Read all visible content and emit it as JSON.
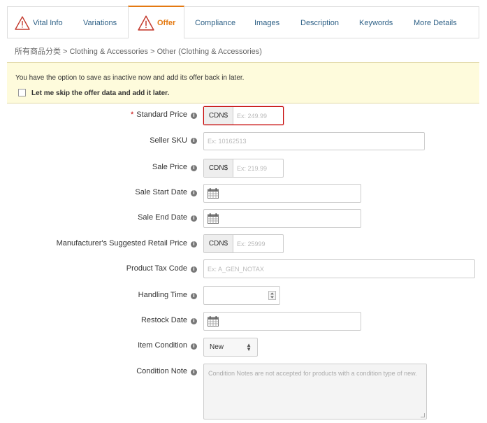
{
  "tabs": [
    {
      "label": "Vital Info",
      "warning": true
    },
    {
      "label": "Variations"
    },
    {
      "label": "Offer",
      "warning": true,
      "active": true
    },
    {
      "label": "Compliance"
    },
    {
      "label": "Images"
    },
    {
      "label": "Description"
    },
    {
      "label": "Keywords"
    },
    {
      "label": "More Details"
    }
  ],
  "breadcrumb": "所有商品分类 > Clothing & Accessories > Other (Clothing & Accessories)",
  "notice": {
    "text": "You have the option to save as inactive now and add its offer back in later.",
    "checkbox_label": "Let me skip the offer data and add it later."
  },
  "form": {
    "standard_price": {
      "label": "Standard Price",
      "required": true,
      "currency": "CDN$",
      "placeholder": "Ex: 249.99"
    },
    "seller_sku": {
      "label": "Seller SKU",
      "placeholder": "Ex: 10162513"
    },
    "sale_price": {
      "label": "Sale Price",
      "currency": "CDN$",
      "placeholder": "Ex: 219.99"
    },
    "sale_start_date": {
      "label": "Sale Start Date"
    },
    "sale_end_date": {
      "label": "Sale End Date"
    },
    "msrp": {
      "label": "Manufacturer's Suggested Retail Price",
      "currency": "CDN$",
      "placeholder": "Ex: 25999"
    },
    "product_tax_code": {
      "label": "Product Tax Code",
      "placeholder": "Ex: A_GEN_NOTAX"
    },
    "handling_time": {
      "label": "Handling Time"
    },
    "restock_date": {
      "label": "Restock Date"
    },
    "item_condition": {
      "label": "Item Condition",
      "value": "New"
    },
    "condition_note": {
      "label": "Condition Note",
      "placeholder": "Condition Notes are not accepted for products with a condition type of new."
    }
  },
  "icons": {
    "info": "info-icon",
    "calendar": "calendar-icon",
    "warning": "warning-icon"
  },
  "colors": {
    "active_tab": "#e47911",
    "link": "#2c5f85",
    "required": "#c40000",
    "notice_bg": "#fefbdc"
  }
}
